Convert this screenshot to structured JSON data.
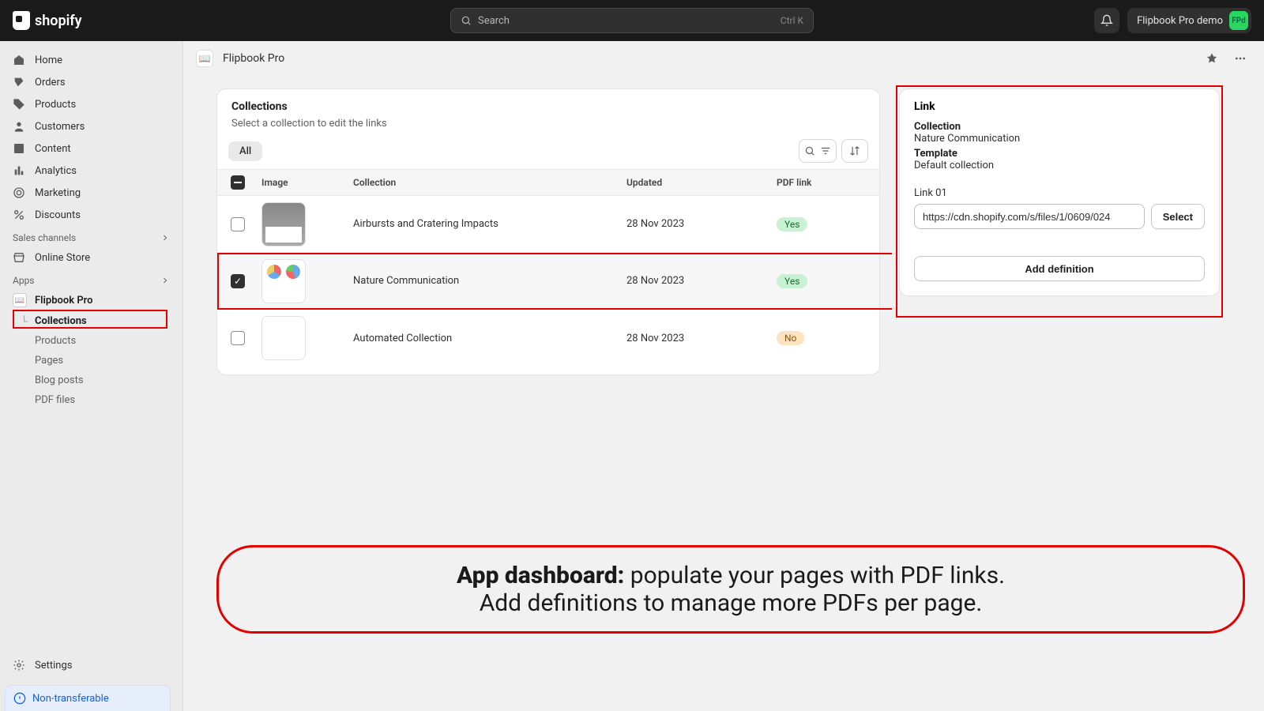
{
  "topbar": {
    "brand": "shopify",
    "search_placeholder": "Search",
    "search_shortcut": "Ctrl K",
    "store_name": "Flipbook Pro demo",
    "avatar_initials": "FPd"
  },
  "sidebar": {
    "primary": [
      {
        "icon": "home",
        "label": "Home"
      },
      {
        "icon": "orders",
        "label": "Orders"
      },
      {
        "icon": "products",
        "label": "Products"
      },
      {
        "icon": "customers",
        "label": "Customers"
      },
      {
        "icon": "content",
        "label": "Content"
      },
      {
        "icon": "analytics",
        "label": "Analytics"
      },
      {
        "icon": "marketing",
        "label": "Marketing"
      },
      {
        "icon": "discounts",
        "label": "Discounts"
      }
    ],
    "sales_channels_label": "Sales channels",
    "sales_channels": [
      {
        "icon": "store",
        "label": "Online Store"
      }
    ],
    "apps_label": "Apps",
    "app_name": "Flipbook Pro",
    "app_subnav": [
      "Collections",
      "Products",
      "Pages",
      "Blog posts",
      "PDF files"
    ],
    "settings_label": "Settings",
    "non_transferable": "Non-transferable"
  },
  "page": {
    "app_title": "Flipbook Pro"
  },
  "main_card": {
    "title": "Collections",
    "subtitle": "Select a collection to edit the links",
    "tab_all": "All",
    "columns": {
      "image": "Image",
      "collection": "Collection",
      "updated": "Updated",
      "pdf": "PDF link"
    },
    "rows": [
      {
        "checked": false,
        "name": "Airbursts and Cratering Impacts",
        "updated": "28 Nov 2023",
        "pdf": "Yes"
      },
      {
        "checked": true,
        "name": "Nature Communication",
        "updated": "28 Nov 2023",
        "pdf": "Yes"
      },
      {
        "checked": false,
        "name": "Automated Collection",
        "updated": "28 Nov 2023",
        "pdf": "No"
      }
    ]
  },
  "side_panel": {
    "title": "Link",
    "collection_label": "Collection",
    "collection_value": "Nature Communication",
    "template_label": "Template",
    "template_value": "Default collection",
    "link_label": "Link 01",
    "link_value": "https://cdn.shopify.com/s/files/1/0609/024",
    "select_btn": "Select",
    "add_btn": "Add definition"
  },
  "callout": {
    "bold": "App dashboard:",
    "line1": " populate your pages with PDF links.",
    "line2": "Add definitions to manage more PDFs per page."
  }
}
